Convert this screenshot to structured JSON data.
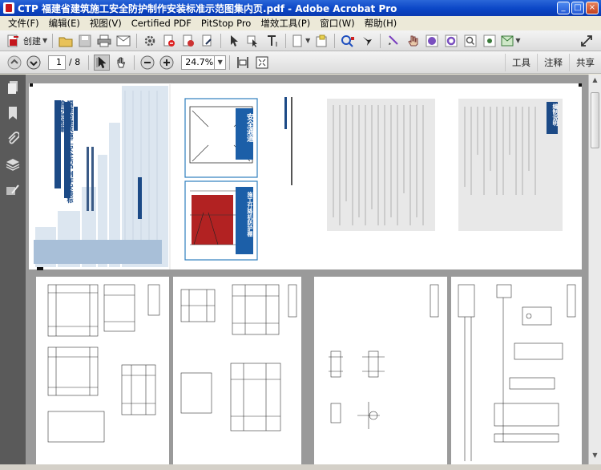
{
  "window": {
    "title": "CTP 福建省建筑施工安全防护制作安装标准示范图集内页.pdf - Adobe Acrobat Pro",
    "minimize": "_",
    "maximize": "□",
    "close": "×"
  },
  "menu": {
    "items": [
      "文件(F)",
      "编辑(E)",
      "视图(V)",
      "Certified PDF",
      "PitStop Pro",
      "增效工具(P)",
      "窗口(W)",
      "帮助(H)"
    ]
  },
  "toolbar": {
    "create_label": "创建"
  },
  "nav_toolbar": {
    "page_current": "1",
    "page_total": "/ 8",
    "zoom": "24.7%"
  },
  "right_buttons": [
    "工具",
    "注释",
    "共享"
  ],
  "colors": {
    "accent": "#0b46c6",
    "cover_blue": "#1c4a86",
    "banner_blue": "#2f7fbf",
    "hoist_red": "#b22222"
  },
  "pages": {
    "cover_title": "福建省建筑施工安全防护制作安装标准示范图集",
    "banner1": "安全通道",
    "banner2": "施工升降机防护棚",
    "directory_heading": "编制说明"
  }
}
